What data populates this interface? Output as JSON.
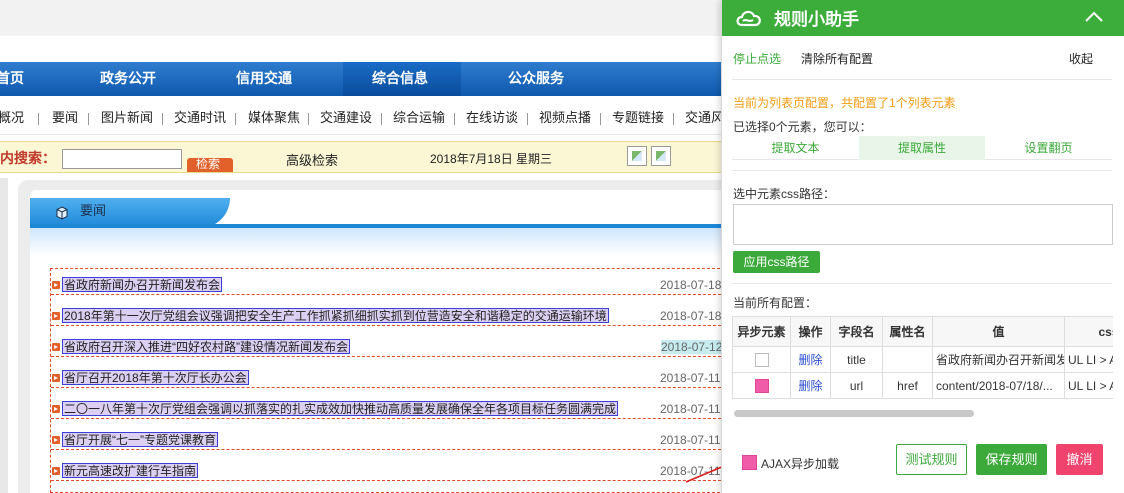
{
  "background_page": {
    "nav_main": [
      "首页",
      "政务公开",
      "信用交通",
      "综合信息",
      "公众服务"
    ],
    "nav_sub": [
      "概况",
      "要闻",
      "图片新闻",
      "交通时讯",
      "媒体聚焦",
      "交通建设",
      "综合运输",
      "在线访谈",
      "视频点播",
      "专题链接",
      "交通风"
    ],
    "search_label": "站内搜索：",
    "search_button": "检索",
    "advanced_search": "高级检索",
    "date_text": "2018年7月18日  星期三",
    "news_section_title": "要闻",
    "news_items": [
      {
        "title": "省政府新闻办召开新闻发布会",
        "date": "2018-07-18"
      },
      {
        "title": "2018年第十一次厅党组会议强调把安全生产工作抓紧抓细抓实抓到位营造安全和谐稳定的交通运输环境",
        "date": "2018-07-18"
      },
      {
        "title": "省政府召开深入推进“四好农村路”建设情况新闻发布会",
        "date": "2018-07-12"
      },
      {
        "title": "省厅召开2018年第十次厅长办公会",
        "date": "2018-07-11"
      },
      {
        "title": "二〇一八年第十次厅党组会强调以抓落实的扎实成效加快推动高质量发展确保全年各项目标任务圆满完成",
        "date": "2018-07-11"
      },
      {
        "title": "省厅开展“七一”专题党课教育",
        "date": "2018-07-11"
      },
      {
        "title": "新元高速改扩建行车指南",
        "date": "2018-07-11"
      }
    ]
  },
  "helper": {
    "title": "规则小助手",
    "toolbar": {
      "stop_select": "停止点选",
      "clear_all": "清除所有配置",
      "collapse": "收起"
    },
    "info_list_page": "当前为列表页配置，共配置了1个列表元素",
    "info_selected": "已选择0个元素，您可以：",
    "actions": [
      "提取文本",
      "提取属性",
      "设置翻页"
    ],
    "css_path_label": "选中元素css路径：",
    "css_path_value": "",
    "apply_css_button": "应用css路径",
    "current_configs_label": "当前所有配置：",
    "table": {
      "headers": [
        "异步元素",
        "操作",
        "字段名",
        "属性名",
        "值",
        "css"
      ],
      "rows": [
        {
          "async": false,
          "action": "删除",
          "field": "title",
          "attr": "",
          "value": "省政府新闻办召开新闻发布会",
          "css": "UL LI > A"
        },
        {
          "async": true,
          "action": "删除",
          "field": "url",
          "attr": "href",
          "value": "content/2018-07/18/...",
          "css": "UL LI > A"
        }
      ]
    },
    "ajax_label": "AJAX异步加载",
    "ajax_checked": true,
    "buttons": {
      "test": "测试规则",
      "save": "保存规则",
      "cancel": "撤消"
    },
    "colors": {
      "brand_green": "#3cac3a",
      "warning_orange": "#f39c12",
      "pink_check": "#f05ca8",
      "cancel_red": "#f0436d"
    }
  }
}
